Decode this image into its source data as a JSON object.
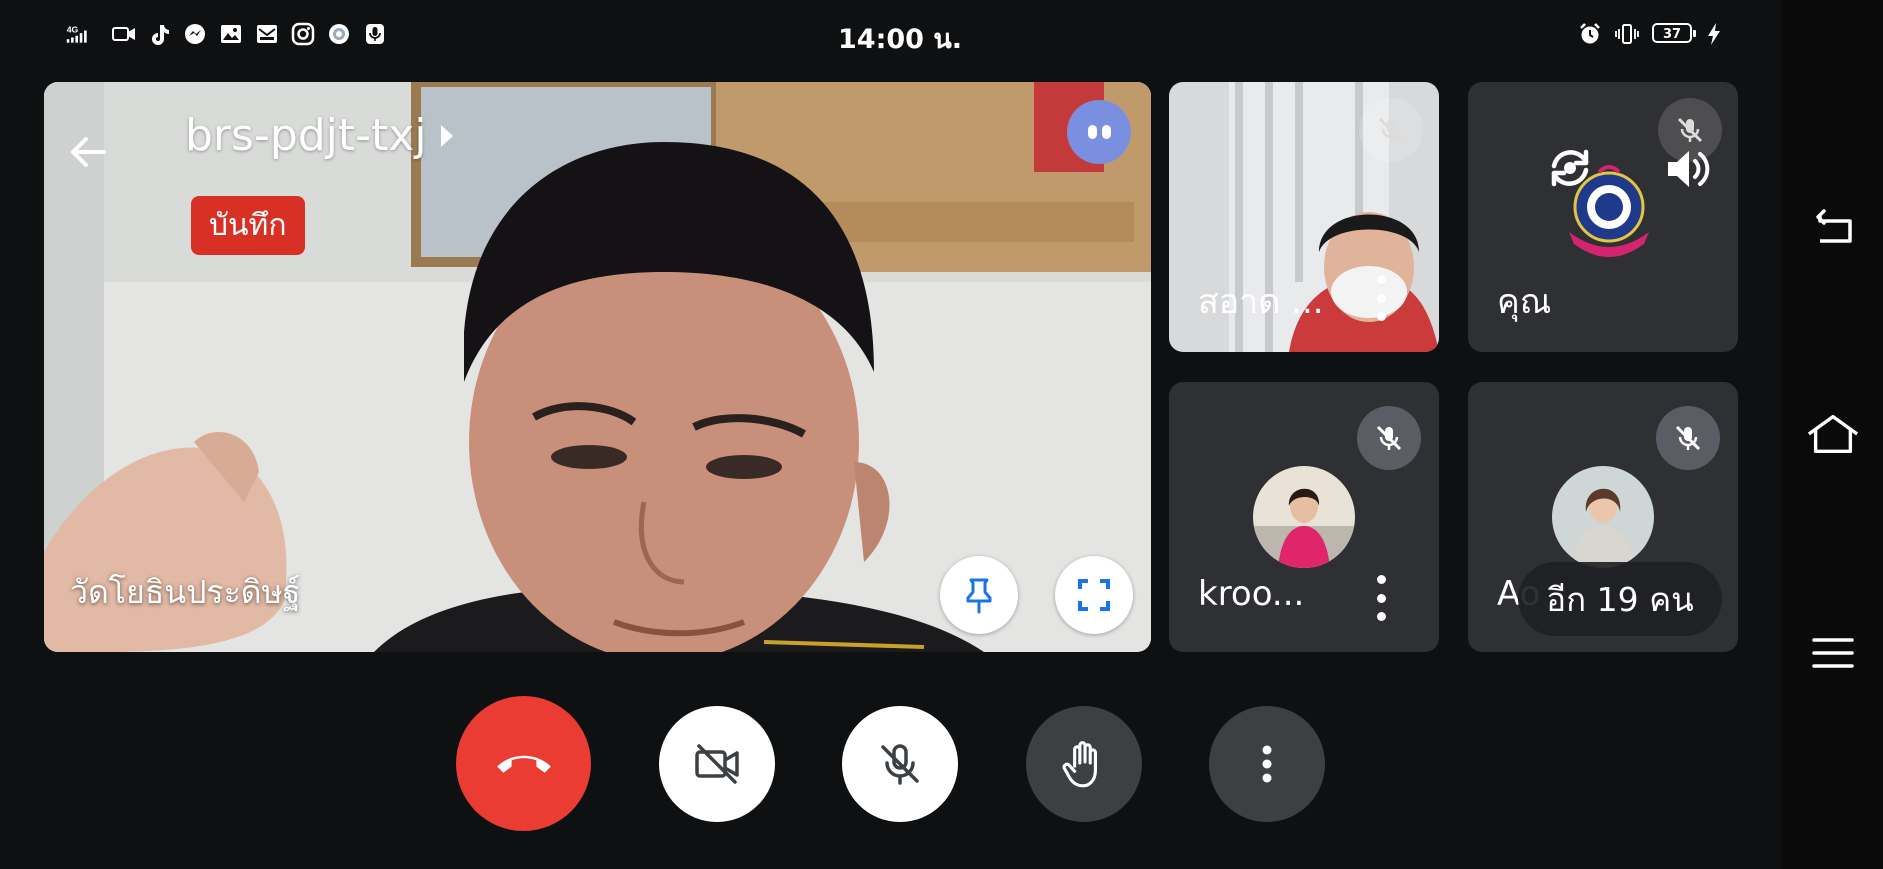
{
  "status_bar": {
    "time": "14:00 น.",
    "network": "4G",
    "battery_level": "37",
    "left_icons": [
      "signal-icon",
      "video-call-icon",
      "tiktok-icon",
      "messenger-icon",
      "gallery-icon",
      "mail-icon",
      "instagram-icon",
      "app-badge-icon",
      "mic-notification-icon"
    ],
    "right_icons": [
      "alarm-icon",
      "vibrate-icon",
      "battery-icon",
      "charging-icon"
    ]
  },
  "meeting": {
    "code": "brs-pdjt-txj",
    "recording_label": "บันทึก"
  },
  "main_tile": {
    "participant_name": "วัดโยธินประดิษฐ์"
  },
  "participants": [
    {
      "name": "สอาด ...",
      "mic": "off"
    },
    {
      "name": "คุณ",
      "mic": "off"
    },
    {
      "name": "kroo...",
      "mic": "off"
    },
    {
      "name": "Ao",
      "mic": "off"
    }
  ],
  "overflow_label": "อีก 19 คน",
  "controls": [
    "end-call",
    "camera-off",
    "mic-off",
    "raise-hand",
    "more-options"
  ],
  "colors": {
    "background": "#0f1012",
    "tile": "#2f3033",
    "end_call": "#ea3c32",
    "recording": "#d93025",
    "accent_blue": "#1a73e8"
  }
}
